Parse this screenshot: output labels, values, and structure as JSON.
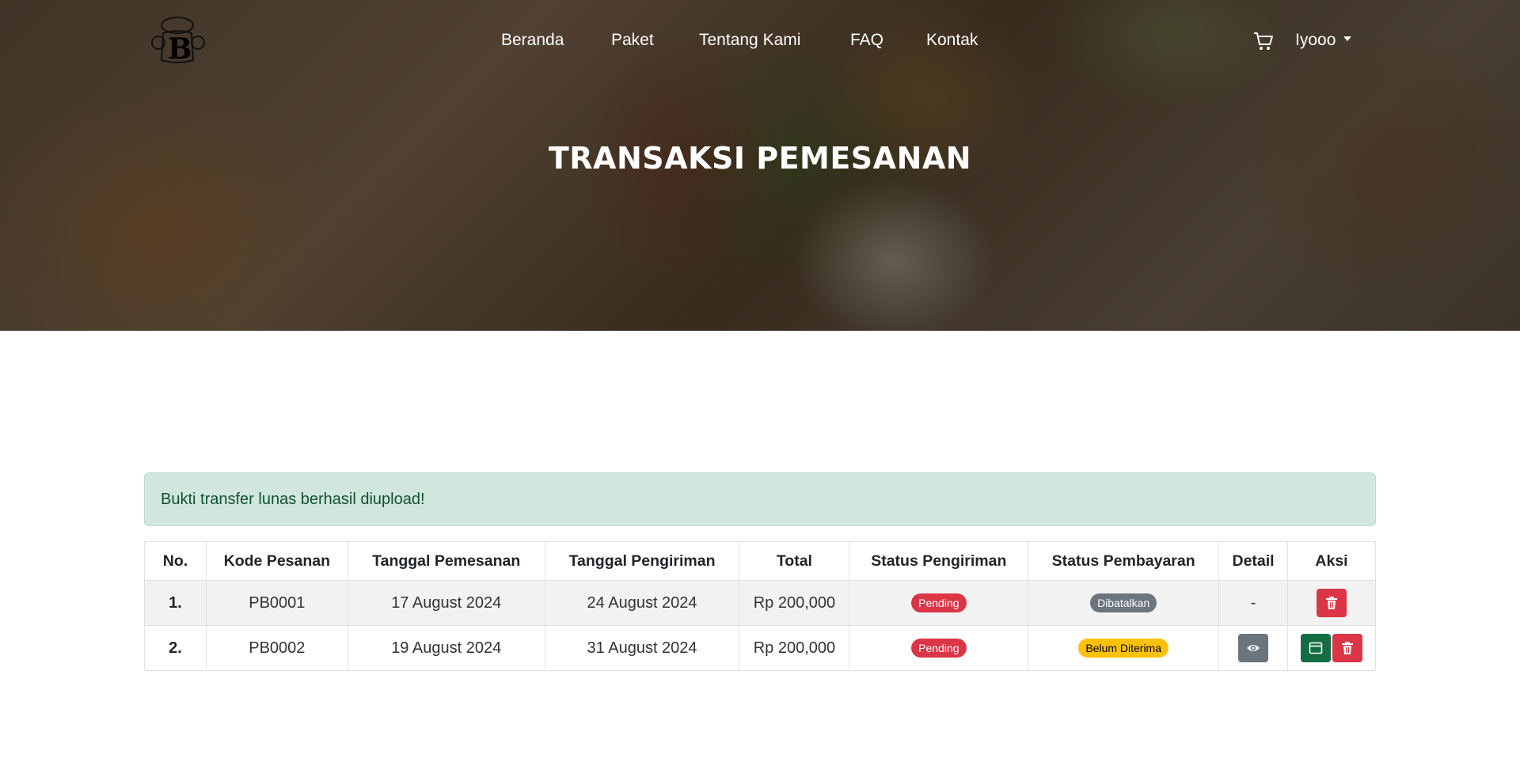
{
  "nav": {
    "items": [
      "Beranda",
      "Paket",
      "Tentang Kami",
      "FAQ",
      "Kontak"
    ],
    "user": "Iyooo"
  },
  "hero": {
    "title": "TRANSAKSI PEMESANAN"
  },
  "alert": {
    "message": "Bukti transfer lunas berhasil diupload!"
  },
  "table": {
    "headers": [
      "No.",
      "Kode Pesanan",
      "Tanggal Pemesanan",
      "Tanggal Pengiriman",
      "Total",
      "Status Pengiriman",
      "Status Pembayaran",
      "Detail",
      "Aksi"
    ],
    "rows": [
      {
        "no": "1.",
        "kode": "PB0001",
        "tanggal_pemesanan": "17 August 2024",
        "tanggal_pengiriman": "24 August 2024",
        "total": "Rp 200,000",
        "status_pengiriman": "Pending",
        "status_pembayaran": "Dibatalkan",
        "detail": "-"
      },
      {
        "no": "2.",
        "kode": "PB0002",
        "tanggal_pemesanan": "19 August 2024",
        "tanggal_pengiriman": "31 August 2024",
        "total": "Rp 200,000",
        "status_pengiriman": "Pending",
        "status_pembayaran": "Belum Diterima"
      }
    ]
  },
  "icons": {
    "cart": "cart-icon",
    "delete": "trash-icon",
    "view": "eye-icon",
    "payment": "window-icon",
    "dropdown": "caret-down-icon"
  },
  "colors": {
    "danger": "#dc3545",
    "secondary": "#6c757d",
    "warning": "#ffc107",
    "success": "#146c43",
    "alert_bg": "#d1e7dd",
    "alert_text": "#0f5132"
  }
}
